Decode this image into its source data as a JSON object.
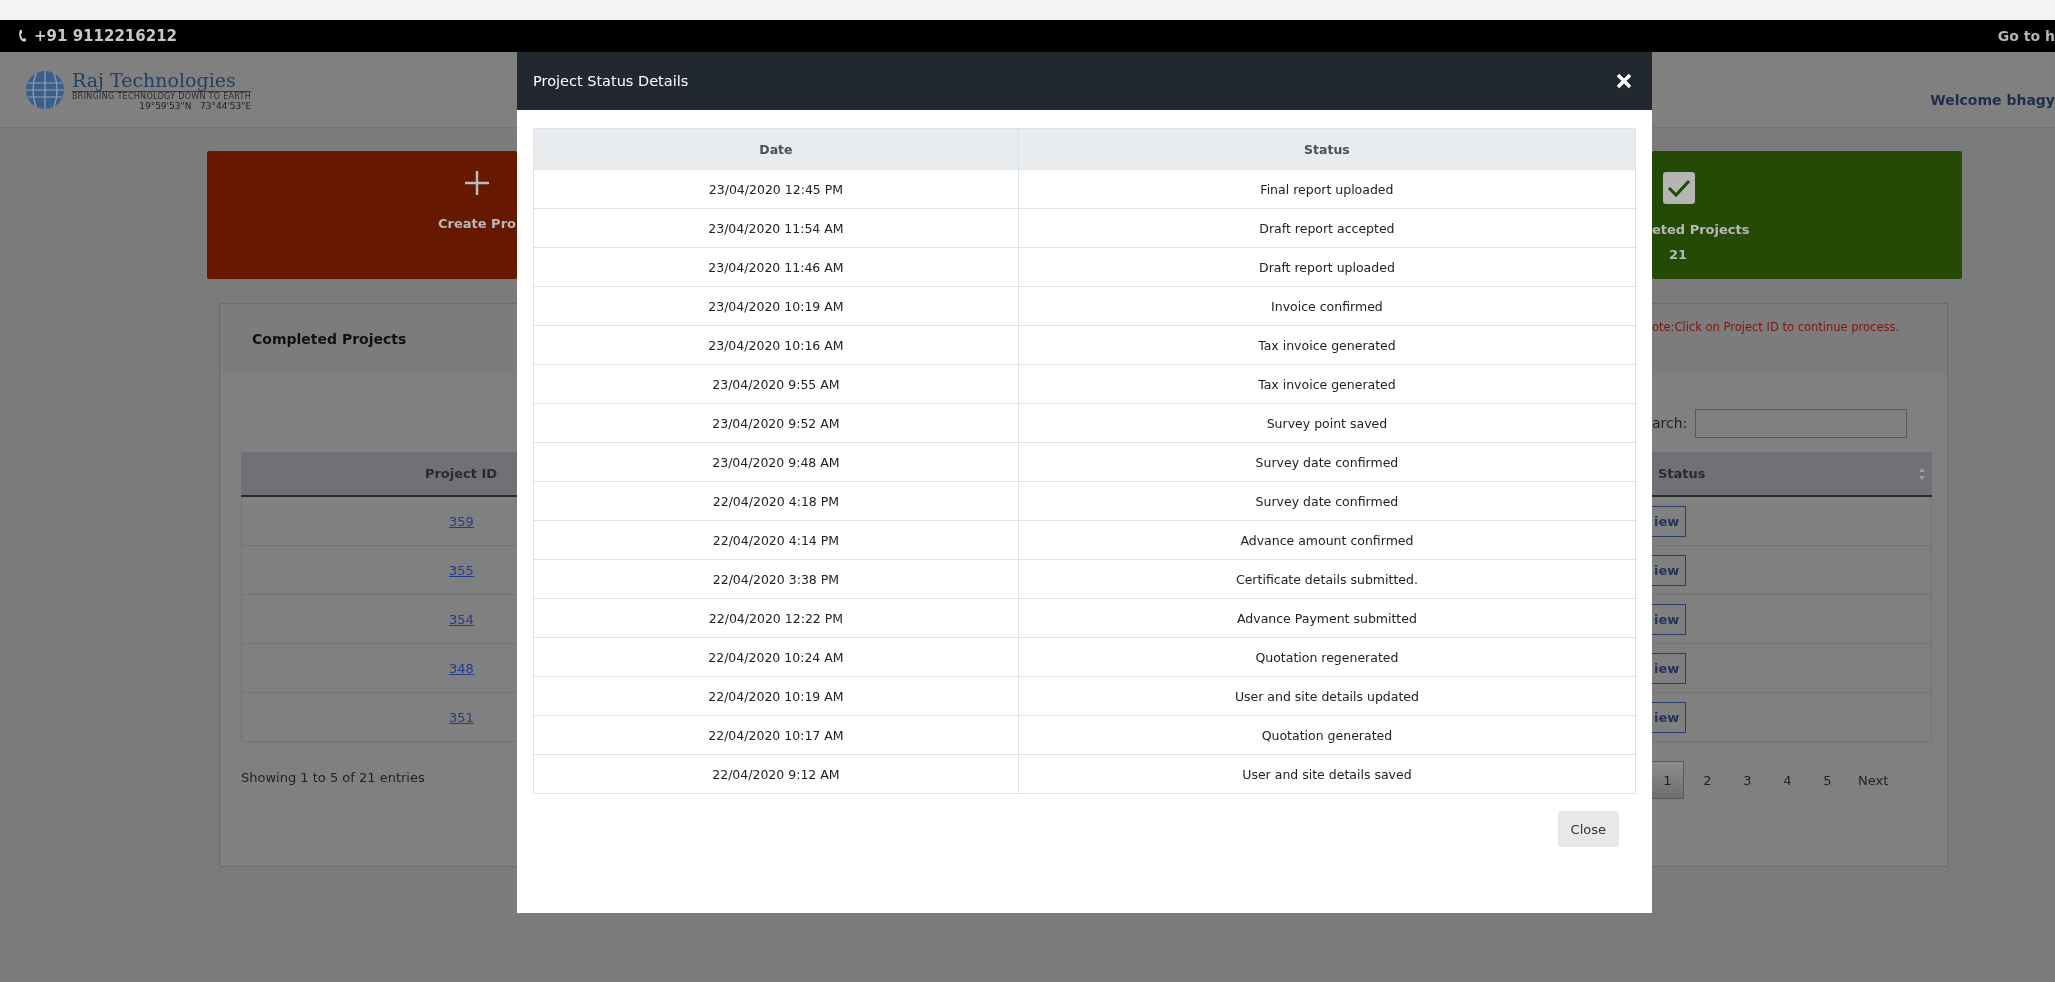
{
  "top_bar": {
    "phone": "+91 9112216212",
    "link": "Go to h"
  },
  "header": {
    "brand": "Raj Technologies",
    "tagline": "BRINGING TECHNOLOGY DOWN TO EARTH",
    "coordinates": "19°59'53\"N   73°44'53\"E",
    "welcome": "Welcome bhagy"
  },
  "tiles": [
    {
      "kind": "create",
      "label": "Create Pro"
    },
    {
      "kind": "completed",
      "label": "eted Projects",
      "count": "21"
    }
  ],
  "card": {
    "title": "Completed Projects",
    "note": "ote:Click on Project ID to continue process.",
    "search_label": "arch:",
    "columns": [
      "Project ID",
      "Status"
    ],
    "rows": [
      {
        "project_id": "359",
        "action": "iew"
      },
      {
        "project_id": "355",
        "action": "iew"
      },
      {
        "project_id": "354",
        "action": "iew"
      },
      {
        "project_id": "348",
        "action": "iew"
      },
      {
        "project_id": "351",
        "action": "iew"
      }
    ],
    "info": "Showing 1 to 5 of 21 entries",
    "pages": [
      {
        "label": "1",
        "selected": true
      },
      {
        "label": "2",
        "selected": false
      },
      {
        "label": "3",
        "selected": false
      },
      {
        "label": "4",
        "selected": false
      },
      {
        "label": "5",
        "selected": false
      }
    ],
    "next": "Next"
  },
  "modal": {
    "title": "Project Status Details",
    "columns": [
      "Date",
      "Status"
    ],
    "rows": [
      {
        "date": "23/04/2020 12:45 PM",
        "status": "Final report uploaded"
      },
      {
        "date": "23/04/2020 11:54 AM",
        "status": "Draft report accepted"
      },
      {
        "date": "23/04/2020 11:46 AM",
        "status": "Draft report uploaded"
      },
      {
        "date": "23/04/2020 10:19 AM",
        "status": "Invoice confirmed"
      },
      {
        "date": "23/04/2020 10:16 AM",
        "status": "Tax invoice generated"
      },
      {
        "date": "23/04/2020 9:55 AM",
        "status": "Tax invoice generated"
      },
      {
        "date": "23/04/2020 9:52 AM",
        "status": "Survey point saved"
      },
      {
        "date": "23/04/2020 9:48 AM",
        "status": "Survey date confirmed"
      },
      {
        "date": "22/04/2020 4:18 PM",
        "status": "Survey date confirmed"
      },
      {
        "date": "22/04/2020 4:14 PM",
        "status": "Advance amount confirmed"
      },
      {
        "date": "22/04/2020 3:38 PM",
        "status": "Certificate details submitted."
      },
      {
        "date": "22/04/2020 12:22 PM",
        "status": "Advance Payment submitted"
      },
      {
        "date": "22/04/2020 10:24 AM",
        "status": "Quotation regenerated"
      },
      {
        "date": "22/04/2020 10:19 AM",
        "status": "User and site details updated"
      },
      {
        "date": "22/04/2020 10:17 AM",
        "status": "Quotation generated"
      },
      {
        "date": "22/04/2020 9:12 AM",
        "status": "User and site details saved"
      }
    ],
    "close": "Close"
  }
}
